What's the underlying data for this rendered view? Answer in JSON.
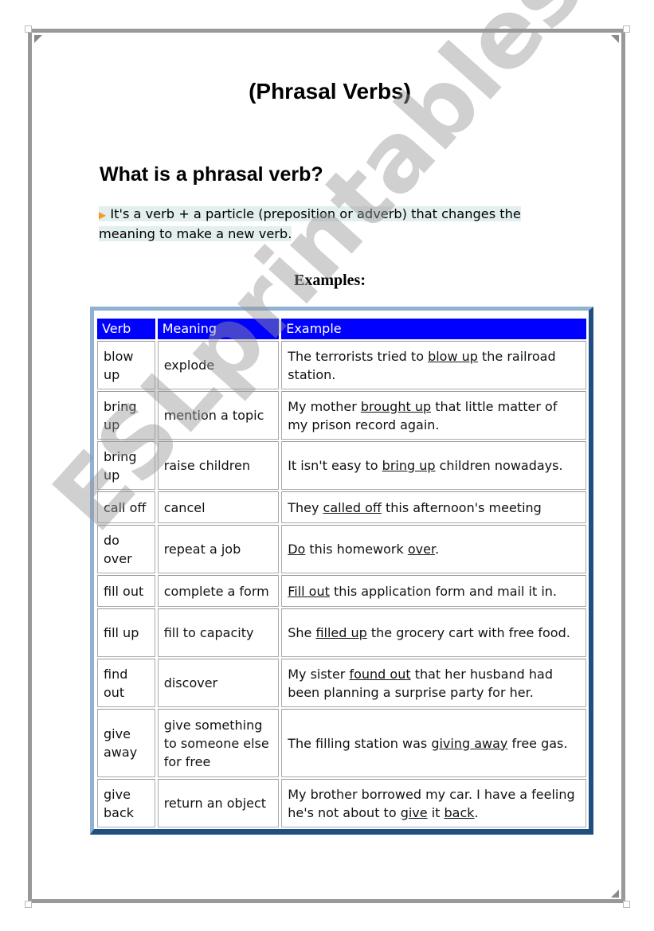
{
  "document": {
    "title": "(Phrasal Verbs)",
    "heading": "What is a phrasal verb?",
    "definition_bullet_icon": "orange-triangle-bullet",
    "definition": "It's a verb + a particle (preposition or adverb) that changes the meaning to make a new verb.",
    "examples_label": "Examples:",
    "watermark": "ESLprintables.com"
  },
  "colors": {
    "header_bg": "#0000ff",
    "header_text": "#ffffff",
    "frame_gray": "#999999",
    "table_border_light": "#8fb2d4",
    "table_border_dark": "#1f4e80",
    "bullet": "#f0a020",
    "definition_highlight": "#e3efef"
  },
  "table": {
    "headers": [
      "Verb",
      "Meaning",
      "Example"
    ],
    "rows": [
      {
        "verb": "blow up",
        "meaning": "explode",
        "example": [
          {
            "t": "The terrorists tried to "
          },
          {
            "t": "blow up",
            "u": true
          },
          {
            "t": " the railroad station."
          }
        ]
      },
      {
        "verb": "bring up",
        "meaning": "mention a topic",
        "example": [
          {
            "t": "My mother "
          },
          {
            "t": "brought up",
            "u": true
          },
          {
            "t": " that little matter of my prison record again."
          }
        ]
      },
      {
        "verb": "bring up",
        "meaning": "raise children",
        "example": [
          {
            "t": "It isn't easy to "
          },
          {
            "t": "bring up",
            "u": true
          },
          {
            "t": " children nowadays."
          }
        ]
      },
      {
        "verb": "call off",
        "meaning": "cancel",
        "example": [
          {
            "t": "They "
          },
          {
            "t": "called off",
            "u": true
          },
          {
            "t": " this afternoon's meeting"
          }
        ]
      },
      {
        "verb": "do over",
        "meaning": "repeat a job",
        "example": [
          {
            "t": "Do",
            "u": true
          },
          {
            "t": " this homework "
          },
          {
            "t": "over",
            "u": true
          },
          {
            "t": "."
          }
        ]
      },
      {
        "verb": "fill out",
        "meaning": "complete a form",
        "example": [
          {
            "t": "Fill out",
            "u": true
          },
          {
            "t": " this application form and mail it in."
          }
        ]
      },
      {
        "verb": "fill up",
        "meaning": "fill to capacity",
        "example": [
          {
            "t": "She "
          },
          {
            "t": "filled up",
            "u": true
          },
          {
            "t": " the grocery cart with free food."
          }
        ]
      },
      {
        "verb": "find out",
        "meaning": "discover",
        "example": [
          {
            "t": "My sister "
          },
          {
            "t": "found out",
            "u": true
          },
          {
            "t": " that her husband had been planning a surprise party for her."
          }
        ]
      },
      {
        "verb": "give away",
        "meaning": "give something to someone else for free",
        "example": [
          {
            "t": "The filling station was "
          },
          {
            "t": "giving away",
            "u": true
          },
          {
            "t": " free gas."
          }
        ]
      },
      {
        "verb": "give back",
        "meaning": "return an object",
        "example": [
          {
            "t": "My brother borrowed my car. I have a feeling he's not about to "
          },
          {
            "t": "give",
            "u": true
          },
          {
            "t": " it "
          },
          {
            "t": "back",
            "u": true
          },
          {
            "t": "."
          }
        ]
      }
    ]
  }
}
